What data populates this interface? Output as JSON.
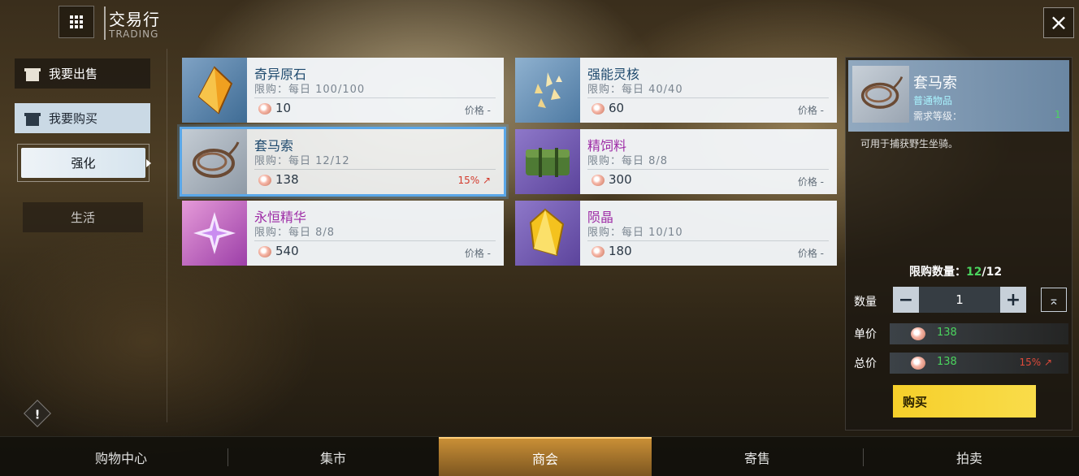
{
  "header": {
    "title": "交易行",
    "subtitle": "TRADING"
  },
  "left_nav": {
    "sell_label": "我要出售",
    "buy_label": "我要购买",
    "sub_items": [
      {
        "label": "强化"
      },
      {
        "label": "生活"
      }
    ]
  },
  "items": [
    {
      "name": "奇异原石",
      "limit": "限购：每日 100/100",
      "price": "10",
      "tag": "价格 -"
    },
    {
      "name": "强能灵核",
      "limit": "限购：每日 40/40",
      "price": "60",
      "tag": "价格 -"
    },
    {
      "name": "套马索",
      "limit": "限购：每日 12/12",
      "price": "138",
      "tag": "15% ↗"
    },
    {
      "name": "精饲料",
      "limit": "限购：每日 8/8",
      "price": "300",
      "tag": "价格 -"
    },
    {
      "name": "永恒精华",
      "limit": "限购：每日 8/8",
      "price": "540",
      "tag": "价格 -"
    },
    {
      "name": "陨晶",
      "limit": "限购：每日 10/10",
      "price": "180",
      "tag": "价格 -"
    }
  ],
  "detail": {
    "name": "套马索",
    "rarity": "普通物品",
    "req_label": "需求等级：",
    "req_value": "1",
    "description": "可用于捕获野生坐骑。",
    "limit_label": "限购数量：",
    "limit_value": "12",
    "limit_total": "/12",
    "qty_label": "数量",
    "qty_value": "1",
    "unit_label": "单价",
    "unit_price": "138",
    "total_label": "总价",
    "total_price": "138",
    "total_pct": "15% ↗",
    "buy_label": "购买"
  },
  "tabs": [
    "购物中心",
    "集市",
    "商会",
    "寄售",
    "拍卖"
  ],
  "colors": {
    "accent_blue": "#5aa7e8",
    "buy_yellow": "#f6cf2a",
    "up_red": "#d33a2c",
    "green": "#4bd45e"
  }
}
